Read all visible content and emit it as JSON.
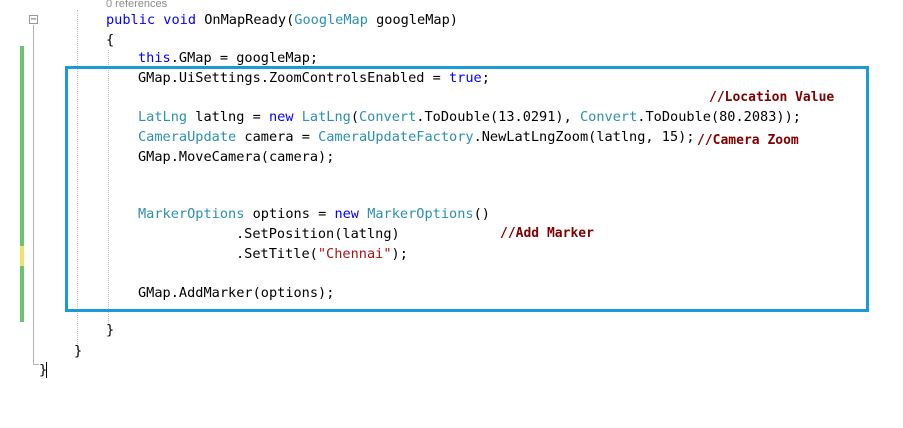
{
  "codelens": "0 references",
  "code": {
    "signature": {
      "kw_public": "public",
      "kw_void": "void",
      "method_name": " OnMapReady(",
      "param_type": "GoogleMap",
      "param_rest": " googleMap)"
    },
    "open_brace": "{",
    "line_gmap_assign": {
      "kw_this": "this",
      "rest": ".GMap = googleMap;"
    },
    "line_zoom": {
      "prefix": "GMap.UiSettings.ZoomControlsEnabled = ",
      "kw_true": "true",
      "suffix": ";"
    },
    "line_latlng": {
      "type1": "LatLng",
      "text1": " latlng = ",
      "kw_new": "new",
      "sp": " ",
      "type2": "LatLng",
      "open": "(",
      "type3": "Convert",
      "text2": ".ToDouble(13.0291), ",
      "type4": "Convert",
      "text3": ".ToDouble(80.2083));"
    },
    "line_camera": {
      "type1": "CameraUpdate",
      "text1": " camera = ",
      "type2": "CameraUpdateFactory",
      "text2": ".NewLatLngZoom(latlng, 15);"
    },
    "line_move": "GMap.MoveCamera(camera);",
    "line_marker": {
      "type1": "MarkerOptions",
      "text1": " options = ",
      "kw_new": "new",
      "sp": " ",
      "type2": "MarkerOptions",
      "text2": "()"
    },
    "line_setpos": ".SetPosition(latlng)",
    "line_settitle": {
      "prefix": ".SetTitle(",
      "str": "\"Chennai\"",
      "suffix": ");"
    },
    "line_addmarker": "GMap.AddMarker(options);",
    "close_method": "}",
    "close_class": "}",
    "close_ns": "}"
  },
  "annotations": {
    "location": "//Location Value",
    "camera": "//Camera Zoom",
    "marker": "//Add Marker"
  },
  "colors": {
    "highlight_border": "#1a9ad6",
    "keyword": "#0000ff",
    "type": "#2b91af",
    "string": "#a31515",
    "annotation": "#800000"
  }
}
